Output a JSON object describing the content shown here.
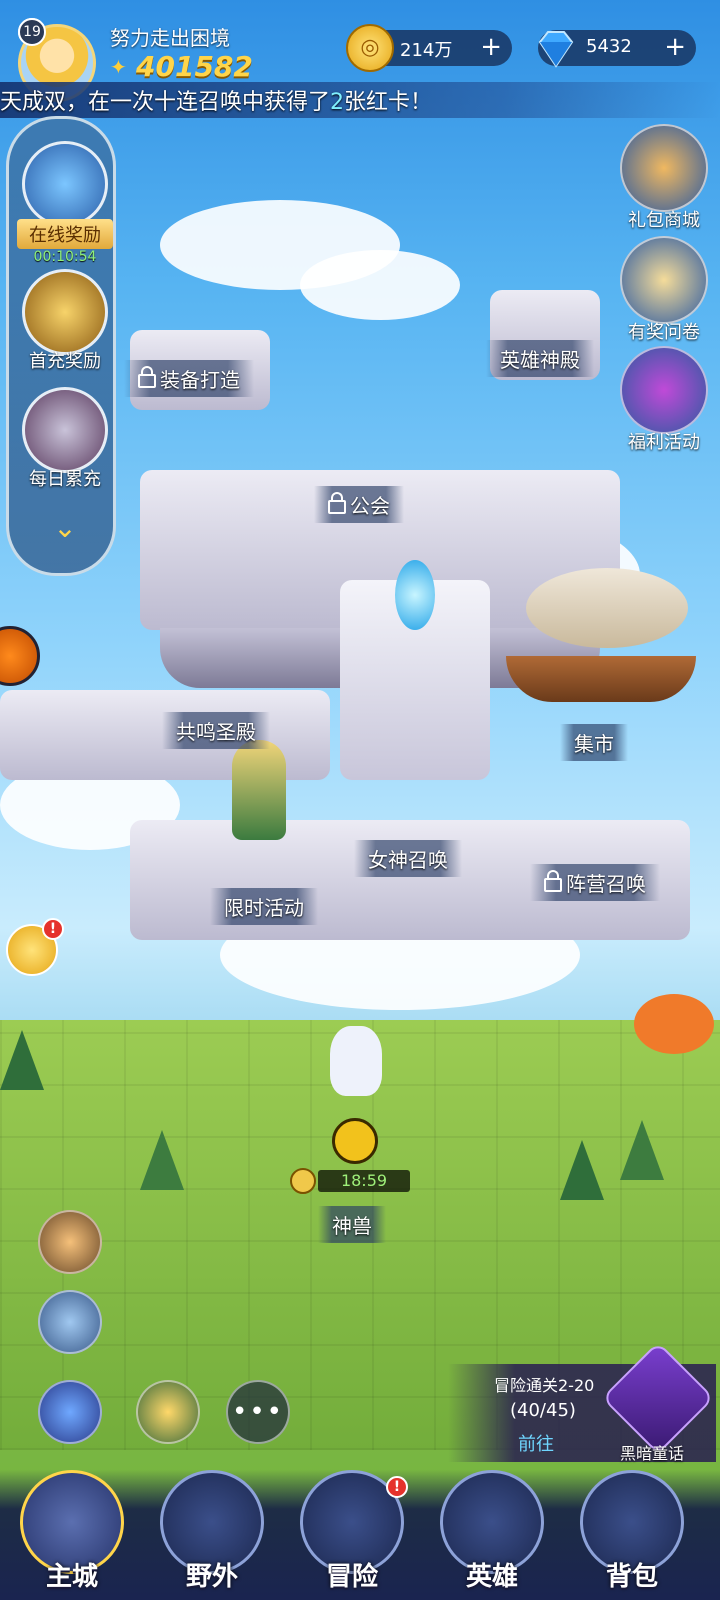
{
  "player": {
    "level": "19",
    "name": "努力走出困境",
    "power": "401582"
  },
  "currency": {
    "gold": "214万",
    "gems": "5432",
    "plus": "+"
  },
  "news": {
    "prefix": "天成双，在一次十连召唤中获得了",
    "count": "2",
    "suffix": "张红卡！"
  },
  "left_panel": {
    "online_reward": "在线奖励",
    "online_timer": "00:10:54",
    "first_recharge": "首充奖励",
    "daily_recharge": "每日累充"
  },
  "right_buttons": {
    "gift_shop": "礼包商城",
    "survey": "有奖问卷",
    "welfare": "福利活动"
  },
  "map": {
    "equipment": "装备打造",
    "hero_temple": "英雄神殿",
    "guild": "公会",
    "resonance": "共鸣圣殿",
    "market": "集市",
    "goddess_summon": "女神召唤",
    "faction_summon": "阵营召唤",
    "limited_event": "限时活动",
    "beast": "神兽",
    "beast_timer": "18:59"
  },
  "adventure": {
    "title": "冒险通关2-20",
    "progress": "(40/45)",
    "go": "前往",
    "dark_tale": "黑暗童话"
  },
  "nav": {
    "main_city": "主城",
    "wild": "野外",
    "adventure": "冒险",
    "heroes": "英雄",
    "bag": "背包"
  },
  "badges": {
    "alert": "!"
  },
  "colors": {
    "gold": "#ffd54a",
    "accent_cyan": "#7ff0ff",
    "timer_green": "#9ff07a"
  }
}
